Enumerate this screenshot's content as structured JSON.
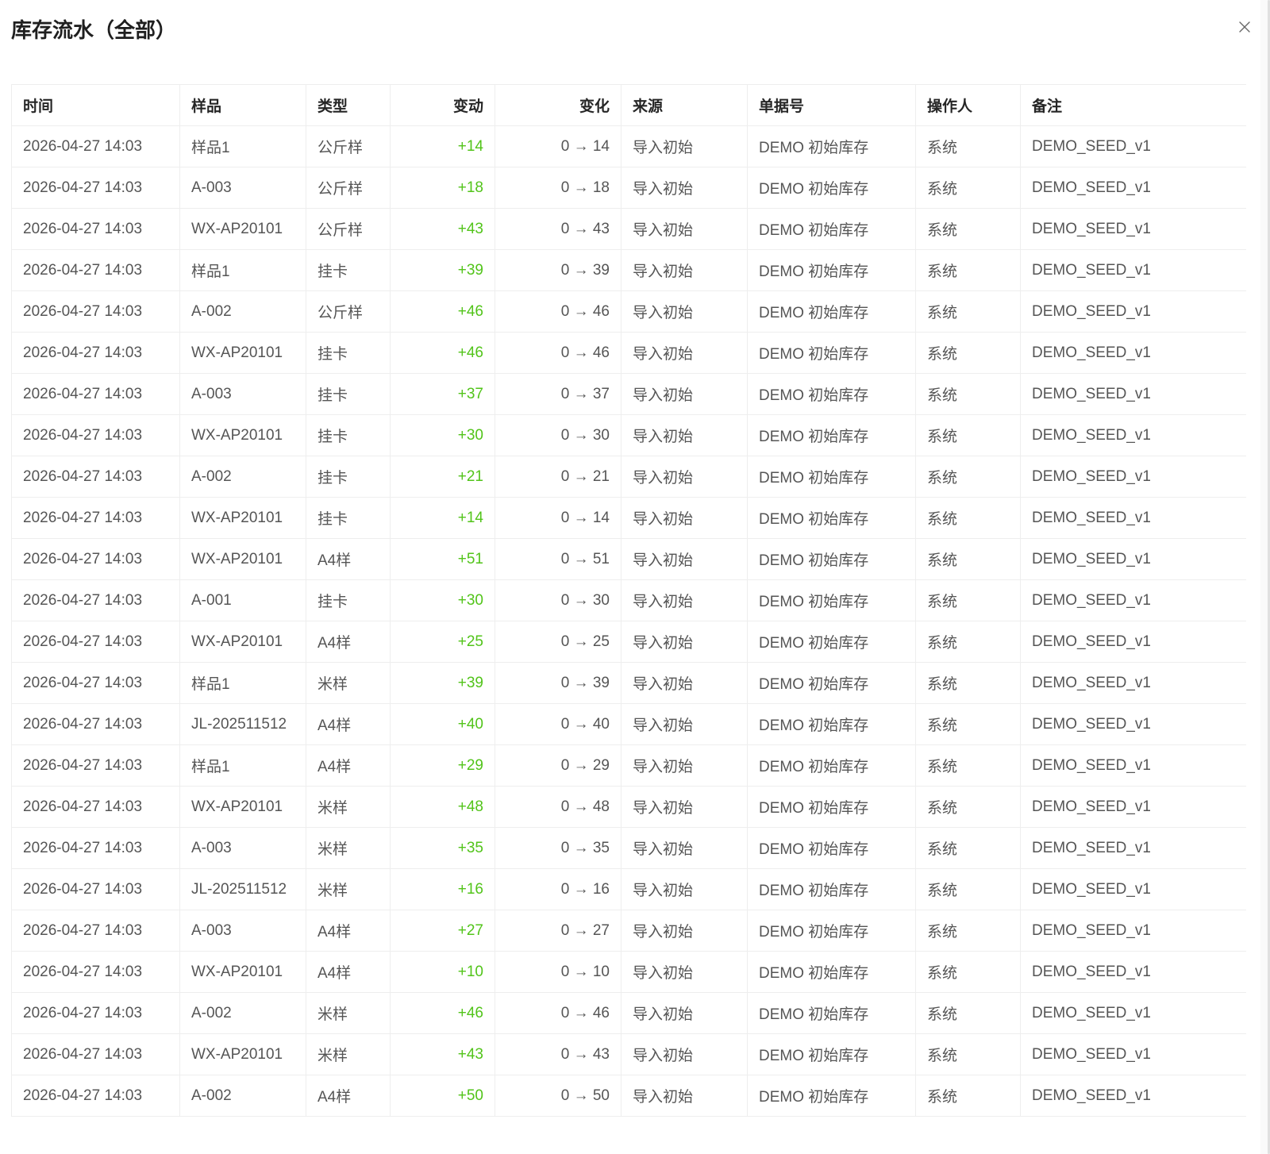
{
  "dialog": {
    "title": "库存流水（全部）"
  },
  "icons": {
    "close": "close-icon"
  },
  "colors": {
    "positive": "#52c41a",
    "text": "#555555",
    "header": "#262626",
    "border": "#eeeeee"
  },
  "table": {
    "columns": [
      "时间",
      "样品",
      "类型",
      "变动",
      "变化",
      "来源",
      "单据号",
      "操作人",
      "备注"
    ],
    "rows": [
      {
        "time": "2026-04-27 14:03",
        "sample": "样品1",
        "type": "公斤样",
        "delta": "+14",
        "change": "0 → 14",
        "source": "导入初始",
        "docno": "DEMO 初始库存",
        "operator": "系统",
        "note": "DEMO_SEED_v1"
      },
      {
        "time": "2026-04-27 14:03",
        "sample": "A-003",
        "type": "公斤样",
        "delta": "+18",
        "change": "0 → 18",
        "source": "导入初始",
        "docno": "DEMO 初始库存",
        "operator": "系统",
        "note": "DEMO_SEED_v1"
      },
      {
        "time": "2026-04-27 14:03",
        "sample": "WX-AP20101",
        "type": "公斤样",
        "delta": "+43",
        "change": "0 → 43",
        "source": "导入初始",
        "docno": "DEMO 初始库存",
        "operator": "系统",
        "note": "DEMO_SEED_v1"
      },
      {
        "time": "2026-04-27 14:03",
        "sample": "样品1",
        "type": "挂卡",
        "delta": "+39",
        "change": "0 → 39",
        "source": "导入初始",
        "docno": "DEMO 初始库存",
        "operator": "系统",
        "note": "DEMO_SEED_v1"
      },
      {
        "time": "2026-04-27 14:03",
        "sample": "A-002",
        "type": "公斤样",
        "delta": "+46",
        "change": "0 → 46",
        "source": "导入初始",
        "docno": "DEMO 初始库存",
        "operator": "系统",
        "note": "DEMO_SEED_v1"
      },
      {
        "time": "2026-04-27 14:03",
        "sample": "WX-AP20101",
        "type": "挂卡",
        "delta": "+46",
        "change": "0 → 46",
        "source": "导入初始",
        "docno": "DEMO 初始库存",
        "operator": "系统",
        "note": "DEMO_SEED_v1"
      },
      {
        "time": "2026-04-27 14:03",
        "sample": "A-003",
        "type": "挂卡",
        "delta": "+37",
        "change": "0 → 37",
        "source": "导入初始",
        "docno": "DEMO 初始库存",
        "operator": "系统",
        "note": "DEMO_SEED_v1"
      },
      {
        "time": "2026-04-27 14:03",
        "sample": "WX-AP20101",
        "type": "挂卡",
        "delta": "+30",
        "change": "0 → 30",
        "source": "导入初始",
        "docno": "DEMO 初始库存",
        "operator": "系统",
        "note": "DEMO_SEED_v1"
      },
      {
        "time": "2026-04-27 14:03",
        "sample": "A-002",
        "type": "挂卡",
        "delta": "+21",
        "change": "0 → 21",
        "source": "导入初始",
        "docno": "DEMO 初始库存",
        "operator": "系统",
        "note": "DEMO_SEED_v1"
      },
      {
        "time": "2026-04-27 14:03",
        "sample": "WX-AP20101",
        "type": "挂卡",
        "delta": "+14",
        "change": "0 → 14",
        "source": "导入初始",
        "docno": "DEMO 初始库存",
        "operator": "系统",
        "note": "DEMO_SEED_v1"
      },
      {
        "time": "2026-04-27 14:03",
        "sample": "WX-AP20101",
        "type": "A4样",
        "delta": "+51",
        "change": "0 → 51",
        "source": "导入初始",
        "docno": "DEMO 初始库存",
        "operator": "系统",
        "note": "DEMO_SEED_v1"
      },
      {
        "time": "2026-04-27 14:03",
        "sample": "A-001",
        "type": "挂卡",
        "delta": "+30",
        "change": "0 → 30",
        "source": "导入初始",
        "docno": "DEMO 初始库存",
        "operator": "系统",
        "note": "DEMO_SEED_v1"
      },
      {
        "time": "2026-04-27 14:03",
        "sample": "WX-AP20101",
        "type": "A4样",
        "delta": "+25",
        "change": "0 → 25",
        "source": "导入初始",
        "docno": "DEMO 初始库存",
        "operator": "系统",
        "note": "DEMO_SEED_v1"
      },
      {
        "time": "2026-04-27 14:03",
        "sample": "样品1",
        "type": "米样",
        "delta": "+39",
        "change": "0 → 39",
        "source": "导入初始",
        "docno": "DEMO 初始库存",
        "operator": "系统",
        "note": "DEMO_SEED_v1"
      },
      {
        "time": "2026-04-27 14:03",
        "sample": "JL-202511512",
        "type": "A4样",
        "delta": "+40",
        "change": "0 → 40",
        "source": "导入初始",
        "docno": "DEMO 初始库存",
        "operator": "系统",
        "note": "DEMO_SEED_v1"
      },
      {
        "time": "2026-04-27 14:03",
        "sample": "样品1",
        "type": "A4样",
        "delta": "+29",
        "change": "0 → 29",
        "source": "导入初始",
        "docno": "DEMO 初始库存",
        "operator": "系统",
        "note": "DEMO_SEED_v1"
      },
      {
        "time": "2026-04-27 14:03",
        "sample": "WX-AP20101",
        "type": "米样",
        "delta": "+48",
        "change": "0 → 48",
        "source": "导入初始",
        "docno": "DEMO 初始库存",
        "operator": "系统",
        "note": "DEMO_SEED_v1"
      },
      {
        "time": "2026-04-27 14:03",
        "sample": "A-003",
        "type": "米样",
        "delta": "+35",
        "change": "0 → 35",
        "source": "导入初始",
        "docno": "DEMO 初始库存",
        "operator": "系统",
        "note": "DEMO_SEED_v1"
      },
      {
        "time": "2026-04-27 14:03",
        "sample": "JL-202511512",
        "type": "米样",
        "delta": "+16",
        "change": "0 → 16",
        "source": "导入初始",
        "docno": "DEMO 初始库存",
        "operator": "系统",
        "note": "DEMO_SEED_v1"
      },
      {
        "time": "2026-04-27 14:03",
        "sample": "A-003",
        "type": "A4样",
        "delta": "+27",
        "change": "0 → 27",
        "source": "导入初始",
        "docno": "DEMO 初始库存",
        "operator": "系统",
        "note": "DEMO_SEED_v1"
      },
      {
        "time": "2026-04-27 14:03",
        "sample": "WX-AP20101",
        "type": "A4样",
        "delta": "+10",
        "change": "0 → 10",
        "source": "导入初始",
        "docno": "DEMO 初始库存",
        "operator": "系统",
        "note": "DEMO_SEED_v1"
      },
      {
        "time": "2026-04-27 14:03",
        "sample": "A-002",
        "type": "米样",
        "delta": "+46",
        "change": "0 → 46",
        "source": "导入初始",
        "docno": "DEMO 初始库存",
        "operator": "系统",
        "note": "DEMO_SEED_v1"
      },
      {
        "time": "2026-04-27 14:03",
        "sample": "WX-AP20101",
        "type": "米样",
        "delta": "+43",
        "change": "0 → 43",
        "source": "导入初始",
        "docno": "DEMO 初始库存",
        "operator": "系统",
        "note": "DEMO_SEED_v1"
      },
      {
        "time": "2026-04-27 14:03",
        "sample": "A-002",
        "type": "A4样",
        "delta": "+50",
        "change": "0 → 50",
        "source": "导入初始",
        "docno": "DEMO 初始库存",
        "operator": "系统",
        "note": "DEMO_SEED_v1"
      }
    ]
  }
}
